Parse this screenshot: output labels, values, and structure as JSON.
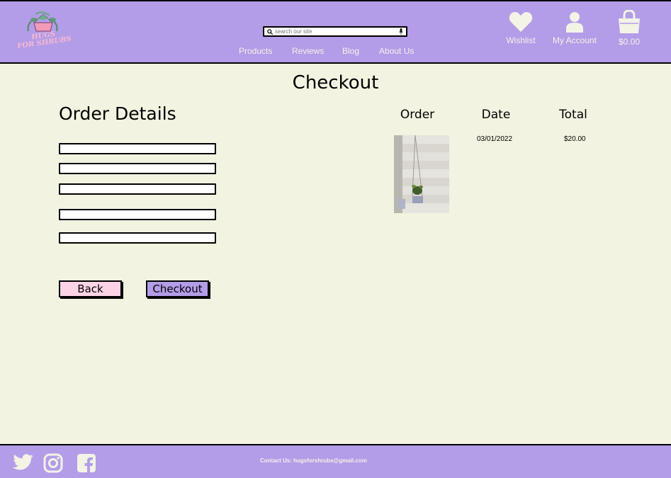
{
  "brand": {
    "name": "HUGS FOR SHRUBS",
    "line1": "HUGS",
    "line2": "FOR SHRUBS",
    "accent": "#b39ce8",
    "pink": "#fcd3e6"
  },
  "search": {
    "placeholder": "search our site"
  },
  "nav": {
    "items": [
      "Products",
      "Reviews",
      "Blog",
      "About Us"
    ]
  },
  "header_actions": {
    "wishlist": "Wishlist",
    "account": "My Account",
    "cart_total": "$0.00"
  },
  "page": {
    "title": "Checkout"
  },
  "order_details": {
    "title": "Order Details",
    "fields": [
      "",
      "",
      "",
      "",
      ""
    ]
  },
  "buttons": {
    "back": "Back",
    "checkout": "Checkout"
  },
  "order_table": {
    "headers": [
      "Order",
      "Date",
      "Total"
    ],
    "rows": [
      {
        "image": "hanging-plant-photo",
        "date": "03/01/2022",
        "total": "$20.00"
      }
    ]
  },
  "footer": {
    "contact": "Contact Us: hugsforshrubs@gmail.com",
    "socials": [
      "twitter-icon",
      "instagram-icon",
      "facebook-icon"
    ]
  }
}
